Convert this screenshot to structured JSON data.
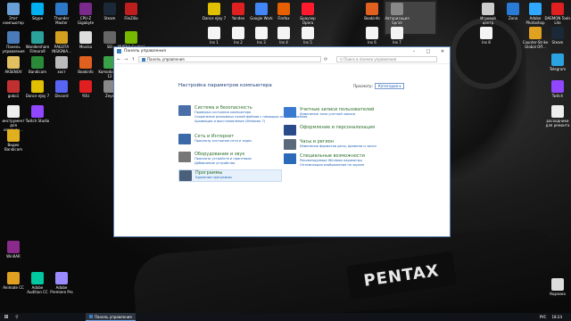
{
  "desktop": {
    "left_icons": [
      {
        "label": "Этот компьютер",
        "color": "#6aa0d8"
      },
      {
        "label": "Skype",
        "color": "#00aff0"
      },
      {
        "label": "Thunder Master",
        "color": "#2e78c8"
      },
      {
        "label": "CPU-Z Gigabyte",
        "color": "#7a2a8a"
      },
      {
        "label": "Steam",
        "color": "#1b2838"
      },
      {
        "label": "FileZilla",
        "color": "#bf1e1e"
      },
      {
        "label": "Панель управления",
        "color": "#4a7ab8"
      },
      {
        "label": "Wondershare Filmora9",
        "color": "#2aa19a"
      },
      {
        "label": "РАБОТА INSIGNIA...",
        "color": "#d4a020"
      },
      {
        "label": "Movika",
        "color": "#ddd"
      },
      {
        "label": "SEI",
        "color": "#666"
      },
      {
        "label": "NVIDIA Control Panel",
        "color": "#76b900"
      },
      {
        "label": "AKSENOV",
        "color": "#e0c060"
      },
      {
        "label": "Bandicam",
        "color": "#2a8a3a"
      },
      {
        "label": "хост",
        "color": "#bbb"
      },
      {
        "label": "Bookinfo",
        "color": "#e06020"
      },
      {
        "label": "Komodo Edit 12",
        "color": "#3aa04a"
      },
      {
        "label": "gobo1",
        "color": "#c03030"
      },
      {
        "label": "Dance eJay 7",
        "color": "#e0c000"
      },
      {
        "label": "Discord",
        "color": "#5865f2"
      },
      {
        "label": "YOU",
        "color": "#e02020"
      },
      {
        "label": "Zeye",
        "color": "#888"
      },
      {
        "label": "инструмент для изменен...",
        "color": "#eee"
      },
      {
        "label": "Twitch Studio",
        "color": "#9146ff"
      },
      {
        "label": "Видео Bandicam",
        "color": "#e0b020"
      },
      {
        "label": "WinRAR",
        "color": "#8a2a8a"
      },
      {
        "label": "Animate CC",
        "color": "#e0a020"
      },
      {
        "label": "Adobe Audition CC",
        "color": "#00c8a0"
      },
      {
        "label": "Adobe Premiere Pro",
        "color": "#9a8aff"
      }
    ],
    "top_icons": [
      {
        "label": "Dance eJay 7",
        "color": "#e0c000"
      },
      {
        "label": "Yandex",
        "color": "#e02020"
      },
      {
        "label": "Google Work",
        "color": "#4285f4"
      },
      {
        "label": "Firefox",
        "color": "#e66000"
      },
      {
        "label": "Браузер Opera",
        "color": "#ff1b2d"
      },
      {
        "label": "Bookinfo",
        "color": "#e06020"
      },
      {
        "label": "Авторизация Sprint",
        "color": "#888"
      },
      {
        "label": "Игровой центр",
        "color": "#ccc"
      },
      {
        "label": "Zona",
        "color": "#2a7ad8"
      },
      {
        "label": "Adobe Photoshop",
        "color": "#31a8ff"
      },
      {
        "label": "DAEMON Tools Lite",
        "color": "#e02020"
      }
    ],
    "file_icons": [
      {
        "label": "Ins 1"
      },
      {
        "label": "Ins 2"
      },
      {
        "label": "Ins 3"
      },
      {
        "label": "Ins 4"
      },
      {
        "label": "Ins 5"
      },
      {
        "label": "Ins 6"
      },
      {
        "label": "Ins 7"
      },
      {
        "label": "Ins 8"
      }
    ],
    "right_icons": [
      {
        "label": "Counter-Strike Global Off...",
        "color": "#e0a020"
      },
      {
        "label": "Steam",
        "color": "#1b2838"
      },
      {
        "label": "Telegram",
        "color": "#2aa3e0"
      },
      {
        "label": "Twitch",
        "color": "#9146ff"
      },
      {
        "label": "расходники для ремонта",
        "color": "#eee"
      },
      {
        "label": "Корзина",
        "color": "#ddd"
      }
    ],
    "camera_brand": "PENTAX"
  },
  "window": {
    "title": "Панель управления",
    "address": "Панель управления",
    "search_placeholder": "Поиск в панели управления",
    "heading": "Настройка параметров компьютера",
    "view_by_label": "Просмотр:",
    "view_by_value": "Категория ▾",
    "categories": [
      {
        "title": "Система и безопасность",
        "color": "#4a6fa8",
        "links": [
          "Проверка состояния компьютера",
          "Сохранение резервных копий файлов с помощью истории файлов",
          "Архивация и восстановление (Windows 7)"
        ]
      },
      {
        "title": "Сеть и Интернет",
        "color": "#3c6aa8",
        "links": [
          "Просмотр состояния сети и задач"
        ]
      },
      {
        "title": "Оборудование и звук",
        "color": "#777",
        "links": [
          "Просмотр устройств и принтеров",
          "Добавление устройства"
        ]
      },
      {
        "title": "Программы",
        "color": "#4a5f7a",
        "links": [
          "Удаление программы"
        ]
      },
      {
        "title": "Учетные записи пользователей",
        "color": "#3a7ad0",
        "links": [
          "Изменение типа учетной записи"
        ]
      },
      {
        "title": "Оформление и персонализация",
        "color": "#2a4a8a",
        "links": []
      },
      {
        "title": "Часы и регион",
        "color": "#5a6a7a",
        "links": [
          "Изменение форматов даты, времени и чисел"
        ]
      },
      {
        "title": "Специальные возможности",
        "color": "#2a6ab8",
        "links": [
          "Рекомендуемые Windows параметры",
          "Оптимизация изображения на экране"
        ]
      }
    ]
  },
  "taskbar": {
    "start_icon": "windows-icon",
    "search_icon": "search-icon",
    "active_app": "Панель управления",
    "tray": {
      "lang": "РУС",
      "time": "18:24"
    }
  }
}
